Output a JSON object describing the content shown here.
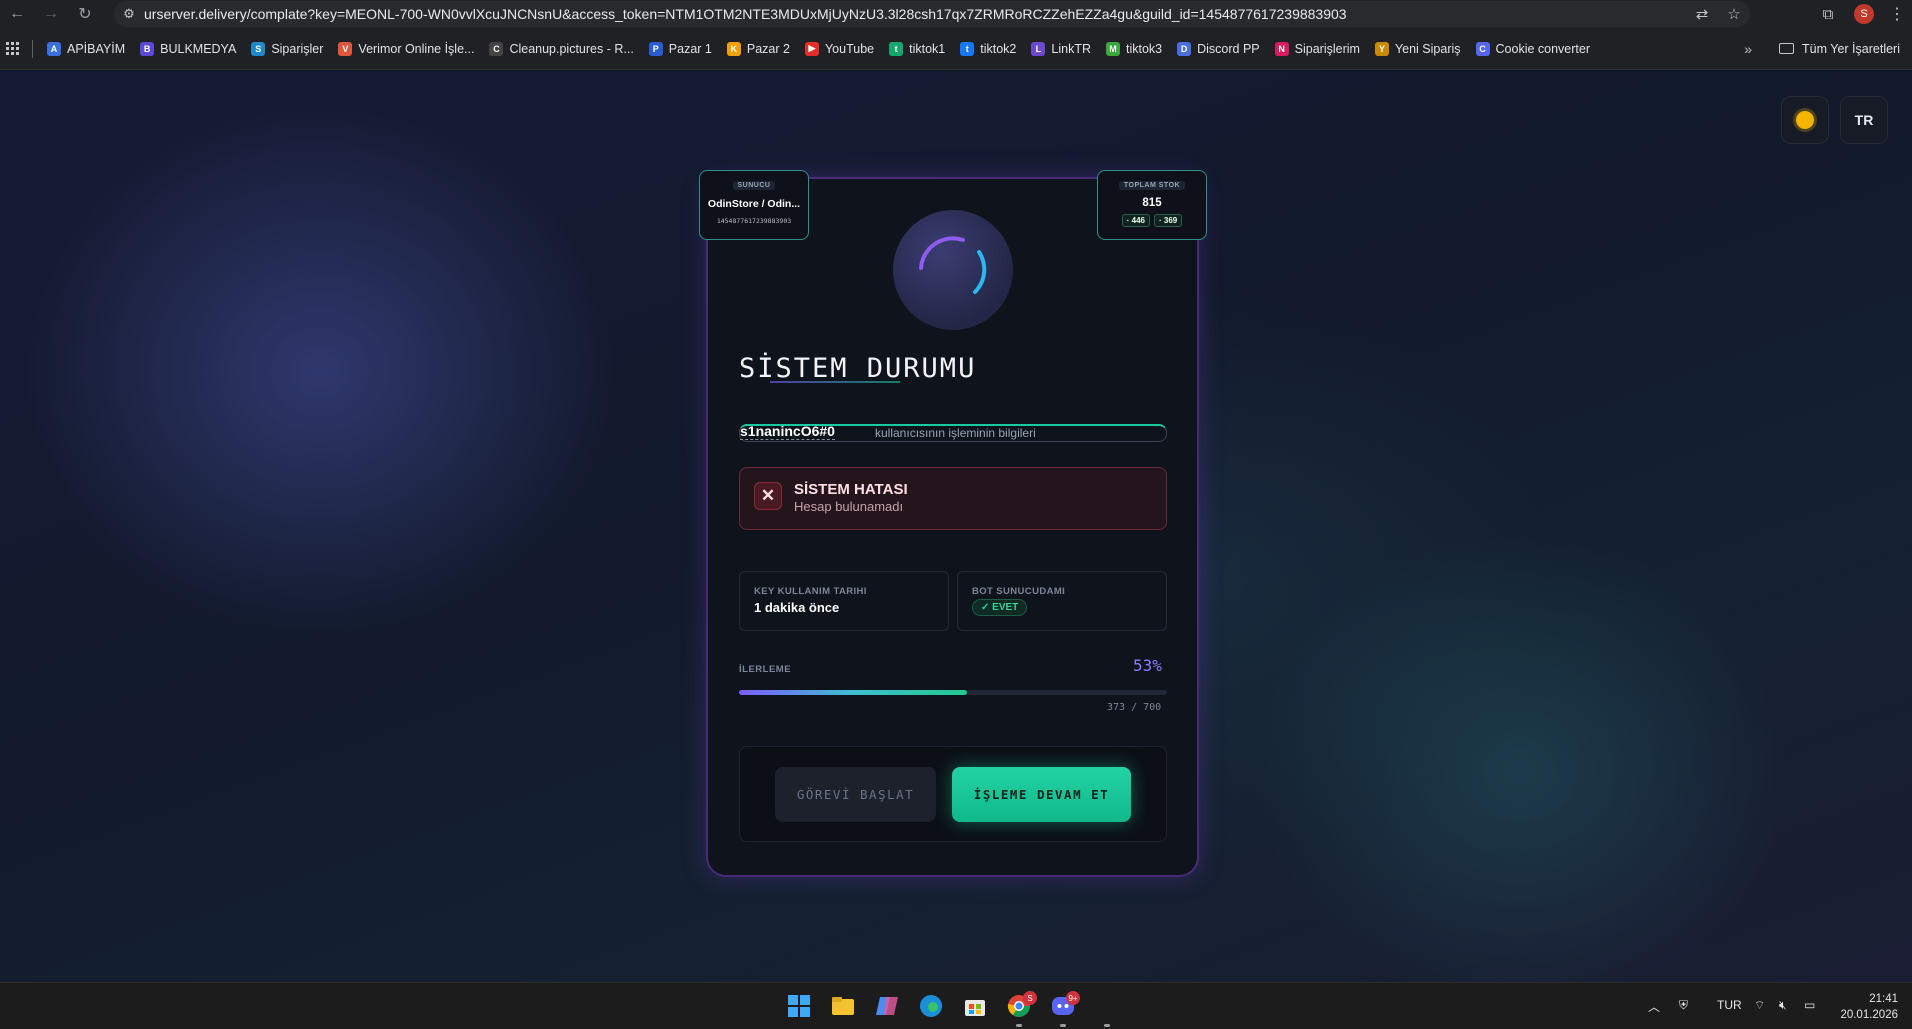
{
  "browser": {
    "url": "urserver.delivery/complate?key=MEONL-700-WN0vvlXcuJNCNsnU&access_token=NTM1OTM2NTE3MDUxMjUyNzU3.3l28csh17qx7ZRMRoRCZZehEZZa4gu&guild_id=1454877617239883903",
    "profile_initial": "S",
    "bookmarks": [
      {
        "label": "APİBAYİM",
        "color": "#3b6fe0",
        "glyph": "A"
      },
      {
        "label": "BULKMEDYA",
        "color": "#5b4ad8",
        "glyph": "B"
      },
      {
        "label": "Siparişler",
        "color": "#1e88c8",
        "glyph": "S"
      },
      {
        "label": "Verimor Online İşle...",
        "color": "#e0563b",
        "glyph": "V"
      },
      {
        "label": "Cleanup.pictures - R...",
        "color": "#444444",
        "glyph": "C"
      },
      {
        "label": "Pazar 1",
        "color": "#2a5bd0",
        "glyph": "P"
      },
      {
        "label": "Pazar 2",
        "color": "#f2a000",
        "glyph": "K"
      },
      {
        "label": "YouTube",
        "color": "#e52d27",
        "glyph": "▶"
      },
      {
        "label": "tiktok1",
        "color": "#15a86e",
        "glyph": "t"
      },
      {
        "label": "tiktok2",
        "color": "#1877f2",
        "glyph": "t"
      },
      {
        "label": "LinkTR",
        "color": "#6a4ad0",
        "glyph": "L"
      },
      {
        "label": "tiktok3",
        "color": "#3aa83a",
        "glyph": "M"
      },
      {
        "label": "Discord PP",
        "color": "#4a6ee0",
        "glyph": "D"
      },
      {
        "label": "Siparişlerim",
        "color": "#d81b60",
        "glyph": "N"
      },
      {
        "label": "Yeni Sipariş",
        "color": "#c98a00",
        "glyph": "Y"
      },
      {
        "label": "Cookie converter",
        "color": "#5865f2",
        "glyph": "C"
      }
    ],
    "all_bookmarks_label": "Tüm Yer İşaretleri"
  },
  "page": {
    "theme_icon": "sun-icon",
    "lang_label": "TR",
    "server_tag": {
      "label": "SUNUCU",
      "name": "OdinStore / Odin...",
      "id": "1454877617239883903"
    },
    "stock_tag": {
      "label": "TOPLAM STOK",
      "total": "815",
      "chip_a": "· 446",
      "chip_b": "· 369"
    },
    "title": "SİSTEM DURUMU",
    "username": "s1nanincO6#0",
    "user_desc": "kullanıcısının işleminin bilgileri",
    "error": {
      "title": "SİSTEM HATASI",
      "message": "Hesap bulunamadı"
    },
    "key_usage": {
      "label": "KEY KULLANIM TARIHI",
      "value": "1 dakika önce"
    },
    "bot_server": {
      "label": "BOT SUNUCUDAMI",
      "value": "✓ EVET"
    },
    "progress": {
      "label": "İLERLEME",
      "percent_text": "53%",
      "current": 373,
      "total": 700,
      "count_text": "373 / 700"
    },
    "buttons": {
      "start": "GÖREVİ BAŞLAT",
      "continue": "İŞLEME DEVAM ET"
    },
    "colors": {
      "accent_purple": "#7b5cff",
      "accent_green": "#14c79a",
      "error_red": "#6a2a36"
    }
  },
  "taskbar": {
    "language": "TUR",
    "time": "21:41",
    "date": "20.01.2026",
    "chrome_badge": "S",
    "discord_badge": "9+"
  }
}
